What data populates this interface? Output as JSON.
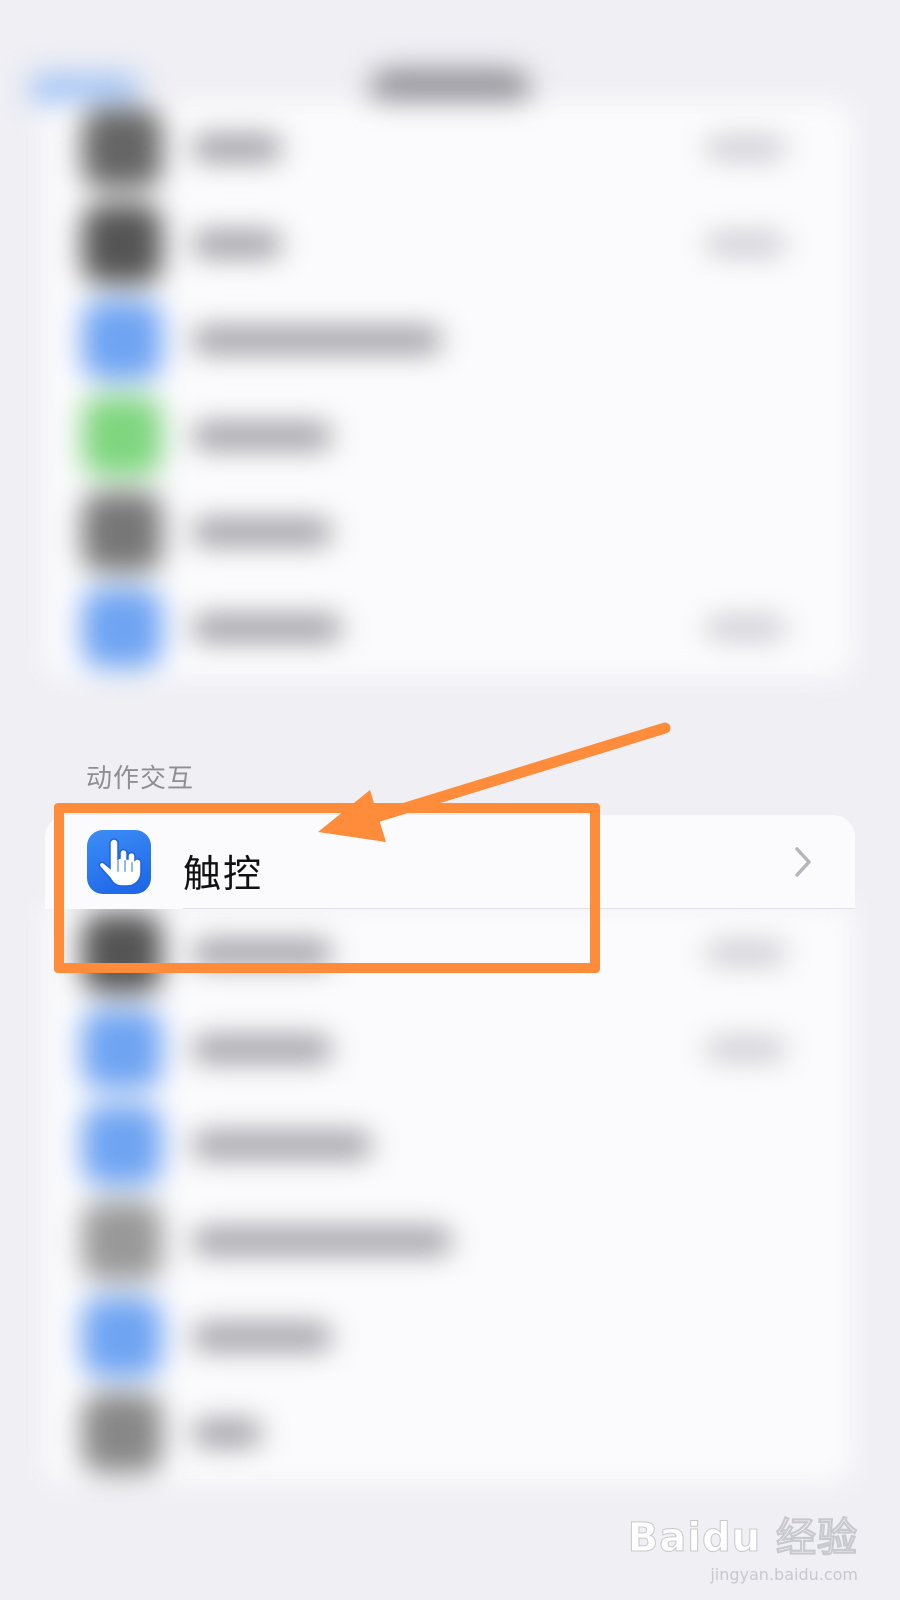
{
  "section": {
    "header": "动作交互"
  },
  "touch_item": {
    "label": "触控",
    "icon": "hand-pointing-icon"
  },
  "annotation": {
    "box_color": "#ff8c3a",
    "arrow_color": "#ff8c3a"
  },
  "watermark": {
    "logo_text": "Baidu 经验",
    "url": "jingyan.baidu.com"
  },
  "colors": {
    "background": "#efeff4",
    "card": "#fbfbfd",
    "accent": "#2f7cf0"
  }
}
